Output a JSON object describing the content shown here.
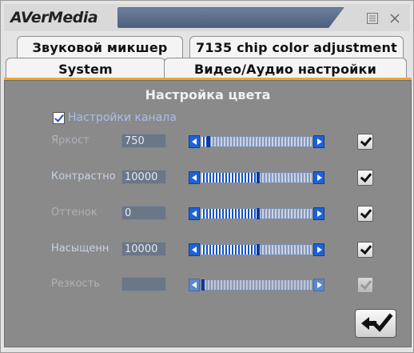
{
  "app": {
    "logo": "AVerMedia",
    "title": "",
    "menu_icon": "menu-icon",
    "close_icon": "close-icon"
  },
  "tabs": [
    {
      "label": "Звуковой микшер"
    },
    {
      "label": "7135 chip color adjustment"
    },
    {
      "label": "System"
    },
    {
      "label": "Видео/Аудио настройки"
    }
  ],
  "colors": {
    "accent": "#f1a530",
    "panel": "#8a8a8a",
    "slider": "#1d63d6"
  },
  "panel": {
    "title": "Настройка цвета",
    "channel_checkbox": {
      "label": "Настройки канала",
      "checked": true
    },
    "rows": [
      {
        "label": "Яркост",
        "value": "750",
        "level": 0.05,
        "checked": true,
        "enabled": true
      },
      {
        "label": "Контрастно",
        "value": "10000",
        "level": 0.5,
        "checked": true,
        "enabled": true
      },
      {
        "label": "Оттенок",
        "value": "0",
        "level": 0.5,
        "checked": true,
        "enabled": true
      },
      {
        "label": "Насыщенн",
        "value": "10000",
        "level": 0.5,
        "checked": true,
        "enabled": true
      },
      {
        "label": "Резкость",
        "value": "",
        "level": 0.0,
        "checked": true,
        "enabled": false
      }
    ],
    "apply_icon": "swap-arrow-check-icon"
  }
}
